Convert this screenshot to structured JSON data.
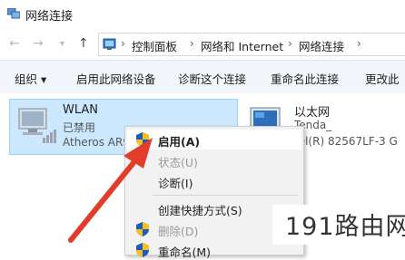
{
  "window": {
    "title": "网络连接"
  },
  "nav": {
    "back": "←",
    "forward": "→",
    "up": "↑"
  },
  "breadcrumb": {
    "items": [
      "控制面板",
      "网络和 Internet",
      "网络连接"
    ],
    "separator": "›"
  },
  "toolbar": {
    "organize": "组织 ▾",
    "enable_device": "启用此网络设备",
    "diagnose": "诊断这个连接",
    "rename": "重命名此连接",
    "more": "更改此"
  },
  "adapters": {
    "wlan": {
      "name": "WLAN",
      "status": "已禁用",
      "device": "Atheros AR9"
    },
    "ethernet": {
      "name": "以太网",
      "status": "Tenda_",
      "device": "tel(R) 82567LF-3 G"
    }
  },
  "context_menu": {
    "enable": "启用(A)",
    "status": "状态(U)",
    "diagnose": "诊断(I)",
    "shortcut": "创建快捷方式(S)",
    "delete": "删除(D)",
    "rename": "重命名(M)"
  },
  "watermark": "191路由网",
  "colors": {
    "selection_bg": "#cce8ff",
    "arrow": "#e23c2b",
    "shield_blue": "#1e5bbf",
    "shield_yellow": "#f2c21b"
  }
}
